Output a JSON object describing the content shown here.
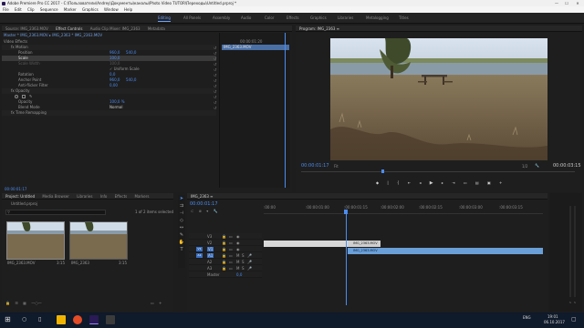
{
  "window": {
    "title": "Adobe Premiere Pro CC 2017 - C:\\Пользователи\\Andrey\\Документы\\каналы\\Photo Video TUTOR\\Переходы\\Untitled.prproj *",
    "min": "—",
    "max": "☐",
    "close": "✕"
  },
  "menu": [
    "File",
    "Edit",
    "Clip",
    "Sequence",
    "Marker",
    "Graphics",
    "Window",
    "Help"
  ],
  "workspaces": [
    {
      "label": "Editing",
      "active": true
    },
    {
      "label": "All Panels",
      "active": false
    },
    {
      "label": "Assembly",
      "active": false
    },
    {
      "label": "Audio",
      "active": false
    },
    {
      "label": "Color",
      "active": false
    },
    {
      "label": "Effects",
      "active": false
    },
    {
      "label": "Graphics",
      "active": false
    },
    {
      "label": "Libraries",
      "active": false
    },
    {
      "label": "Metalogging",
      "active": false
    },
    {
      "label": "Titles",
      "active": false
    }
  ],
  "effect_controls": {
    "tabs": [
      "Source: IMG_2363.MOV",
      "Effect Controls",
      "Audio Clip Mixer: IMG_2363",
      "Metadata"
    ],
    "clip_header": "Master * IMG_2363.MOV  ▸  IMG_2363 * IMG_2363.MOV",
    "section": "Video Effects",
    "rows": [
      {
        "label": "fx  Motion",
        "value": "",
        "value2": ""
      },
      {
        "label": "Position",
        "value": "960,0",
        "value2": "540,0"
      },
      {
        "label": "Scale",
        "value": "100,0",
        "value2": ""
      },
      {
        "label": "Scale Width",
        "value": "100,0",
        "value2": ""
      },
      {
        "label": "",
        "value": "",
        "value2": "✓ Uniform Scale"
      },
      {
        "label": "Rotation",
        "value": "0,0",
        "value2": ""
      },
      {
        "label": "Anchor Point",
        "value": "960,0",
        "value2": "540,0"
      },
      {
        "label": "Anti-flicker Filter",
        "value": "0,00",
        "value2": ""
      },
      {
        "label": "fx  Opacity",
        "value": "",
        "value2": ""
      },
      {
        "label": "",
        "value": "",
        "value2": ""
      },
      {
        "label": "Opacity",
        "value": "100,0 %",
        "value2": ""
      },
      {
        "label": "Blend Mode",
        "value": "Normal",
        "value2": ""
      },
      {
        "label": "fx  Time Remapping",
        "value": "",
        "value2": ""
      }
    ],
    "mini_timecode": "00:00:01:20",
    "clip_label": "IMG_2363.MOV",
    "bottom_timecode": "00:00:01:17"
  },
  "program": {
    "title": "Program: IMG_2363  ≡",
    "timecode": "00:00:01:17",
    "fit": "Fit",
    "fraction": "1/2",
    "duration": "00:00:03:15"
  },
  "project": {
    "tabs": [
      "Project: Untitled",
      "Media Browser",
      "Libraries",
      "Info",
      "Effects",
      "Markers"
    ],
    "file": "Untitled.prproj",
    "count": "1 of 2 items selected",
    "items": [
      {
        "name": "IMG_2363.MOV",
        "duration": "3:15"
      },
      {
        "name": "IMG_2363",
        "duration": "3:15"
      }
    ]
  },
  "timeline": {
    "tab": "IMG_2363  ≡",
    "timecode": "00:00:01:17",
    "ruler": [
      ":00:00",
      ":00:00:01:00",
      ":00:00:01:15",
      ":00:00:02:00",
      ":00:00:02:15",
      ":00:00:03:00",
      ":00:00:03:15"
    ],
    "video_tracks": [
      "V3",
      "V2",
      "V1"
    ],
    "audio_tracks": [
      "A1",
      "A2",
      "A3"
    ],
    "master": "Master",
    "master_value": "0,0",
    "clip_v2": "IMG_2363.MOV",
    "clip_v1": "IMG_2363.MOV"
  },
  "taskbar": {
    "time": "19:01",
    "date": "06.10.2017",
    "lang": "ENG"
  },
  "colors": {
    "accent": "#4b8cf0",
    "clip": "#cfcfcf",
    "clip_blue": "#6a9fd8",
    "playhead": "#4b8cf0"
  }
}
